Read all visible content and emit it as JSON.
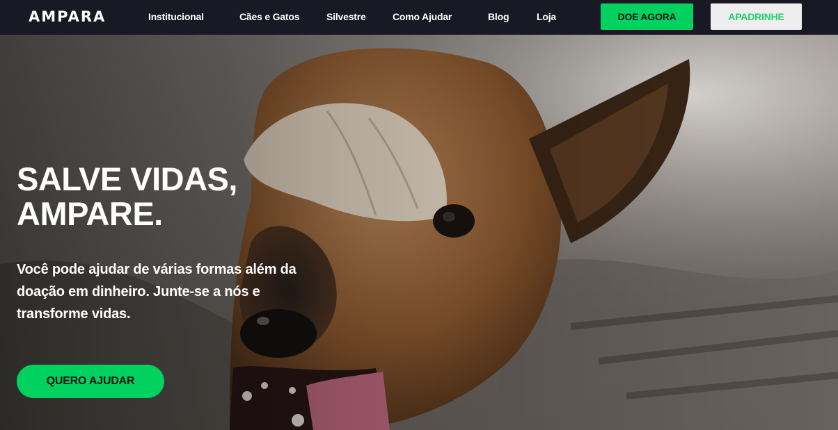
{
  "brand": {
    "logo_text": "AMPARA"
  },
  "nav": {
    "links": [
      "Institucional",
      "Cães e Gatos",
      "Silvestre",
      "Como Ajudar",
      "Blog",
      "Loja"
    ],
    "donate_label": "DOE AGORA",
    "sponsor_label": "APADRINHE"
  },
  "hero": {
    "title_line1": "SALVE VIDAS,",
    "title_line2": "AMPARE.",
    "subtitle": "Você pode ajudar de várias formas além da doação em dinheiro. Junte-se a nós e transforme vidas.",
    "cta_label": "QUERO AJUDAR",
    "image": "dog-covering-eye-photo"
  },
  "colors": {
    "nav_bg": "#191925",
    "accent_green": "#00d15f",
    "sponsor_bg": "#eeeeee",
    "sponsor_text": "#1fcf6a",
    "text_light": "#ffffff"
  }
}
